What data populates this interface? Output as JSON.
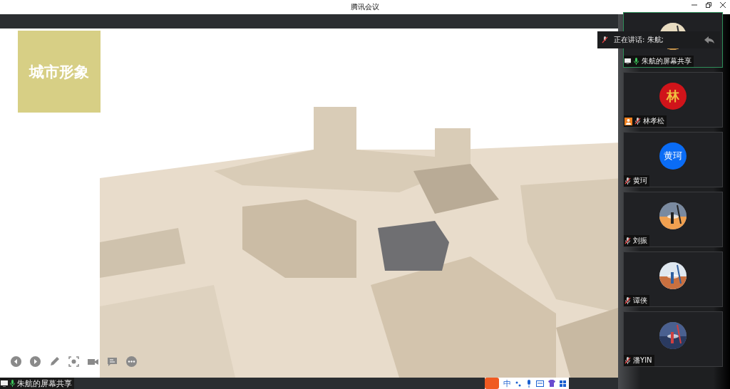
{
  "window": {
    "title": "腾讯会议"
  },
  "slide": {
    "title": "城市形象"
  },
  "speaking_banner": {
    "text": "正在讲话: 朱航;"
  },
  "participants": [
    {
      "name": "朱航的屏幕共享",
      "selected": true,
      "sharing": true,
      "host": false,
      "mic_on": true
    },
    {
      "name": "林孝松",
      "avatar": {
        "kind": "text",
        "text": "林",
        "color": "#d0141a"
      },
      "selected": false,
      "sharing": false,
      "host": true,
      "mic_on": false
    },
    {
      "name": "黄珂",
      "avatar": {
        "kind": "text",
        "text": "黄珂",
        "color": "#0a6cf5"
      },
      "selected": false,
      "sharing": false,
      "host": false,
      "mic_on": false
    },
    {
      "name": "刘振",
      "selected": false,
      "sharing": false,
      "host": false,
      "mic_on": false
    },
    {
      "name": "谭侠",
      "selected": false,
      "sharing": false,
      "host": false,
      "mic_on": false
    },
    {
      "name": "潘YIN",
      "selected": false,
      "sharing": false,
      "host": false,
      "mic_on": false
    }
  ],
  "share_label": {
    "text": "朱航的屏幕共享"
  },
  "ime_toolbar": {
    "mode": "中"
  }
}
